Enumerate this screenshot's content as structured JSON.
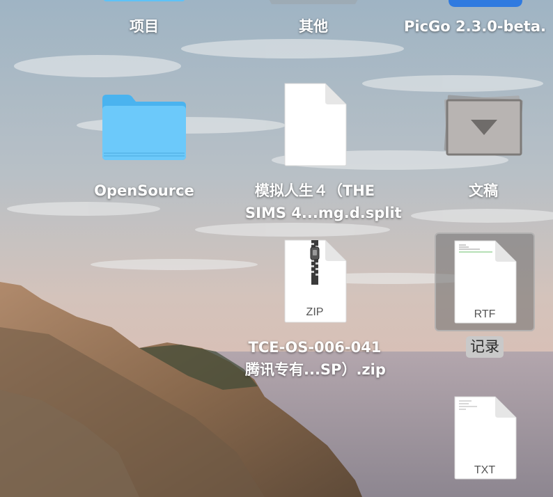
{
  "desktop": {
    "items": [
      {
        "label": "项目",
        "kind": "folder-partial"
      },
      {
        "label": "其他",
        "kind": "generic-partial"
      },
      {
        "label": "PicGo 2.3.0-beta.",
        "kind": "app-partial"
      },
      {
        "label": "OpenSource",
        "kind": "folder"
      },
      {
        "label_line1": "模拟人生４（THE",
        "label_line2": "SIMS 4...mg.d.split",
        "kind": "blank-document"
      },
      {
        "label": "文稿",
        "kind": "documents-stack"
      },
      {
        "label_line1": "TCE-OS-006-041",
        "label_line2": "腾讯专有...SP）.zip",
        "kind": "zip-archive",
        "badge": "ZIP"
      },
      {
        "label": "记录",
        "kind": "rtf-document",
        "badge": "RTF",
        "selected": true
      },
      {
        "label": "",
        "kind": "txt-document",
        "badge": "TXT"
      }
    ]
  },
  "colors": {
    "folder": "#5ec2f7",
    "selection": "#c9c9c9",
    "label_text": "#ffffff"
  }
}
